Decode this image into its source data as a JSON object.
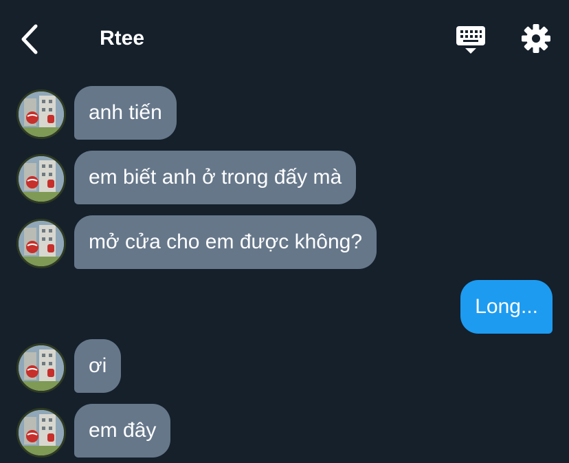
{
  "header": {
    "title": "Rtee",
    "back_icon": "chevron-left-icon",
    "keyboard_icon": "keyboard-icon",
    "settings_icon": "gear-icon"
  },
  "colors": {
    "background": "#15202b",
    "incoming_bubble": "#66778a",
    "outgoing_bubble": "#1d9bf0",
    "text": "#ffffff"
  },
  "messages": [
    {
      "direction": "incoming",
      "text": "anh tiến"
    },
    {
      "direction": "incoming",
      "text": "em biết anh ở trong đấy mà"
    },
    {
      "direction": "incoming",
      "text": "mở cửa cho em được không?"
    },
    {
      "direction": "outgoing",
      "text": "Long..."
    },
    {
      "direction": "incoming",
      "text": "ơi"
    },
    {
      "direction": "incoming",
      "text": "em đây"
    }
  ]
}
